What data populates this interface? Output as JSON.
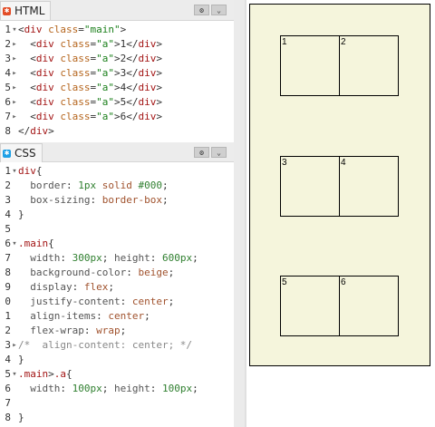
{
  "html_panel": {
    "tab_label": "HTML",
    "gear_glyph": "⚙",
    "chevron_glyph": "⌄",
    "lines": [
      {
        "n": "1",
        "fold": "▾",
        "parts": [
          [
            "pn",
            "<"
          ],
          [
            "t",
            "div"
          ],
          [
            "pn",
            " "
          ],
          [
            "at",
            "class"
          ],
          [
            "pn",
            "="
          ],
          [
            "sv",
            "\"main\""
          ],
          [
            "pn",
            ">"
          ]
        ]
      },
      {
        "n": "2",
        "fold": "▸",
        "parts": [
          [
            "pn",
            "  <"
          ],
          [
            "t",
            "div"
          ],
          [
            "pn",
            " "
          ],
          [
            "at",
            "class"
          ],
          [
            "pn",
            "="
          ],
          [
            "sv",
            "\"a\""
          ],
          [
            "pn",
            ">1</"
          ],
          [
            "t",
            "div"
          ],
          [
            "pn",
            ">"
          ]
        ]
      },
      {
        "n": "3",
        "fold": "▸",
        "parts": [
          [
            "pn",
            "  <"
          ],
          [
            "t",
            "div"
          ],
          [
            "pn",
            " "
          ],
          [
            "at",
            "class"
          ],
          [
            "pn",
            "="
          ],
          [
            "sv",
            "\"a\""
          ],
          [
            "pn",
            ">2</"
          ],
          [
            "t",
            "div"
          ],
          [
            "pn",
            ">"
          ]
        ]
      },
      {
        "n": "4",
        "fold": "▸",
        "parts": [
          [
            "pn",
            "  <"
          ],
          [
            "t",
            "div"
          ],
          [
            "pn",
            " "
          ],
          [
            "at",
            "class"
          ],
          [
            "pn",
            "="
          ],
          [
            "sv",
            "\"a\""
          ],
          [
            "pn",
            ">3</"
          ],
          [
            "t",
            "div"
          ],
          [
            "pn",
            ">"
          ]
        ]
      },
      {
        "n": "5",
        "fold": "▸",
        "parts": [
          [
            "pn",
            "  <"
          ],
          [
            "t",
            "div"
          ],
          [
            "pn",
            " "
          ],
          [
            "at",
            "class"
          ],
          [
            "pn",
            "="
          ],
          [
            "sv",
            "\"a\""
          ],
          [
            "pn",
            ">4</"
          ],
          [
            "t",
            "div"
          ],
          [
            "pn",
            ">"
          ]
        ]
      },
      {
        "n": "6",
        "fold": "▸",
        "parts": [
          [
            "pn",
            "  <"
          ],
          [
            "t",
            "div"
          ],
          [
            "pn",
            " "
          ],
          [
            "at",
            "class"
          ],
          [
            "pn",
            "="
          ],
          [
            "sv",
            "\"a\""
          ],
          [
            "pn",
            ">5</"
          ],
          [
            "t",
            "div"
          ],
          [
            "pn",
            ">"
          ]
        ]
      },
      {
        "n": "7",
        "fold": "▸",
        "parts": [
          [
            "pn",
            "  <"
          ],
          [
            "t",
            "div"
          ],
          [
            "pn",
            " "
          ],
          [
            "at",
            "class"
          ],
          [
            "pn",
            "="
          ],
          [
            "sv",
            "\"a\""
          ],
          [
            "pn",
            ">6</"
          ],
          [
            "t",
            "div"
          ],
          [
            "pn",
            ">"
          ]
        ]
      },
      {
        "n": "8",
        "fold": "",
        "parts": [
          [
            "pn",
            "</"
          ],
          [
            "t",
            "div"
          ],
          [
            "pn",
            ">"
          ]
        ]
      }
    ]
  },
  "css_panel": {
    "tab_label": "CSS",
    "gear_glyph": "⚙",
    "chevron_glyph": "⌄",
    "lines": [
      {
        "n": "1",
        "fold": "▾",
        "parts": [
          [
            "sel",
            "div"
          ],
          [
            "pn",
            "{"
          ]
        ]
      },
      {
        "n": "2",
        "fold": "",
        "parts": [
          [
            "pr",
            "  border"
          ],
          [
            "pn",
            ": "
          ],
          [
            "num",
            "1px"
          ],
          [
            "pn",
            " "
          ],
          [
            "kw",
            "solid"
          ],
          [
            "pn",
            " "
          ],
          [
            "num",
            "#000"
          ],
          [
            "pn",
            ";"
          ]
        ]
      },
      {
        "n": "3",
        "fold": "",
        "parts": [
          [
            "pr",
            "  box-sizing"
          ],
          [
            "pn",
            ": "
          ],
          [
            "kw",
            "border-box"
          ],
          [
            "pn",
            ";"
          ]
        ]
      },
      {
        "n": "4",
        "fold": "",
        "parts": [
          [
            "pn",
            "}"
          ]
        ]
      },
      {
        "n": "5",
        "fold": "",
        "parts": []
      },
      {
        "n": "6",
        "fold": "▾",
        "parts": [
          [
            "sel",
            ".main"
          ],
          [
            "pn",
            "{"
          ]
        ]
      },
      {
        "n": "7",
        "fold": "",
        "parts": [
          [
            "pr",
            "  width"
          ],
          [
            "pn",
            ": "
          ],
          [
            "num",
            "300px"
          ],
          [
            "pn",
            "; "
          ],
          [
            "pr",
            "height"
          ],
          [
            "pn",
            ": "
          ],
          [
            "num",
            "600px"
          ],
          [
            "pn",
            ";"
          ]
        ]
      },
      {
        "n": "8",
        "fold": "",
        "parts": [
          [
            "pr",
            "  background-color"
          ],
          [
            "pn",
            ": "
          ],
          [
            "kw",
            "beige"
          ],
          [
            "pn",
            ";"
          ]
        ]
      },
      {
        "n": "9",
        "fold": "",
        "parts": [
          [
            "pr",
            "  display"
          ],
          [
            "pn",
            ": "
          ],
          [
            "kw",
            "flex"
          ],
          [
            "pn",
            ";"
          ]
        ]
      },
      {
        "n": "0",
        "fold": "",
        "parts": [
          [
            "pr",
            "  justify-content"
          ],
          [
            "pn",
            ": "
          ],
          [
            "kw",
            "center"
          ],
          [
            "pn",
            ";"
          ]
        ]
      },
      {
        "n": "1",
        "fold": "",
        "parts": [
          [
            "pr",
            "  align-items"
          ],
          [
            "pn",
            ": "
          ],
          [
            "kw",
            "center"
          ],
          [
            "pn",
            ";"
          ]
        ]
      },
      {
        "n": "2",
        "fold": "",
        "parts": [
          [
            "pr",
            "  flex-wrap"
          ],
          [
            "pn",
            ": "
          ],
          [
            "kw",
            "wrap"
          ],
          [
            "pn",
            ";"
          ]
        ]
      },
      {
        "n": "3",
        "fold": "▸",
        "parts": [
          [
            "cm",
            "/*  align-content: center; */"
          ]
        ]
      },
      {
        "n": "4",
        "fold": "",
        "parts": [
          [
            "pn",
            "}"
          ]
        ]
      },
      {
        "n": "5",
        "fold": "▾",
        "parts": [
          [
            "sel",
            ".main"
          ],
          [
            "pn",
            ">"
          ],
          [
            "sel",
            ".a"
          ],
          [
            "pn",
            "{"
          ]
        ]
      },
      {
        "n": "6",
        "fold": "",
        "parts": [
          [
            "pr",
            "  width"
          ],
          [
            "pn",
            ": "
          ],
          [
            "num",
            "100px"
          ],
          [
            "pn",
            "; "
          ],
          [
            "pr",
            "height"
          ],
          [
            "pn",
            ": "
          ],
          [
            "num",
            "100px"
          ],
          [
            "pn",
            ";"
          ]
        ]
      },
      {
        "n": "7",
        "fold": "",
        "parts": []
      },
      {
        "n": "8",
        "fold": "",
        "parts": [
          [
            "pn",
            "}"
          ]
        ]
      }
    ]
  },
  "preview": {
    "background": "#f5f5dc",
    "boxes": [
      "1",
      "2",
      "3",
      "4",
      "5",
      "6"
    ]
  },
  "colors": {
    "html_badge": "#e34c26",
    "css_badge": "#1ea0e6"
  }
}
